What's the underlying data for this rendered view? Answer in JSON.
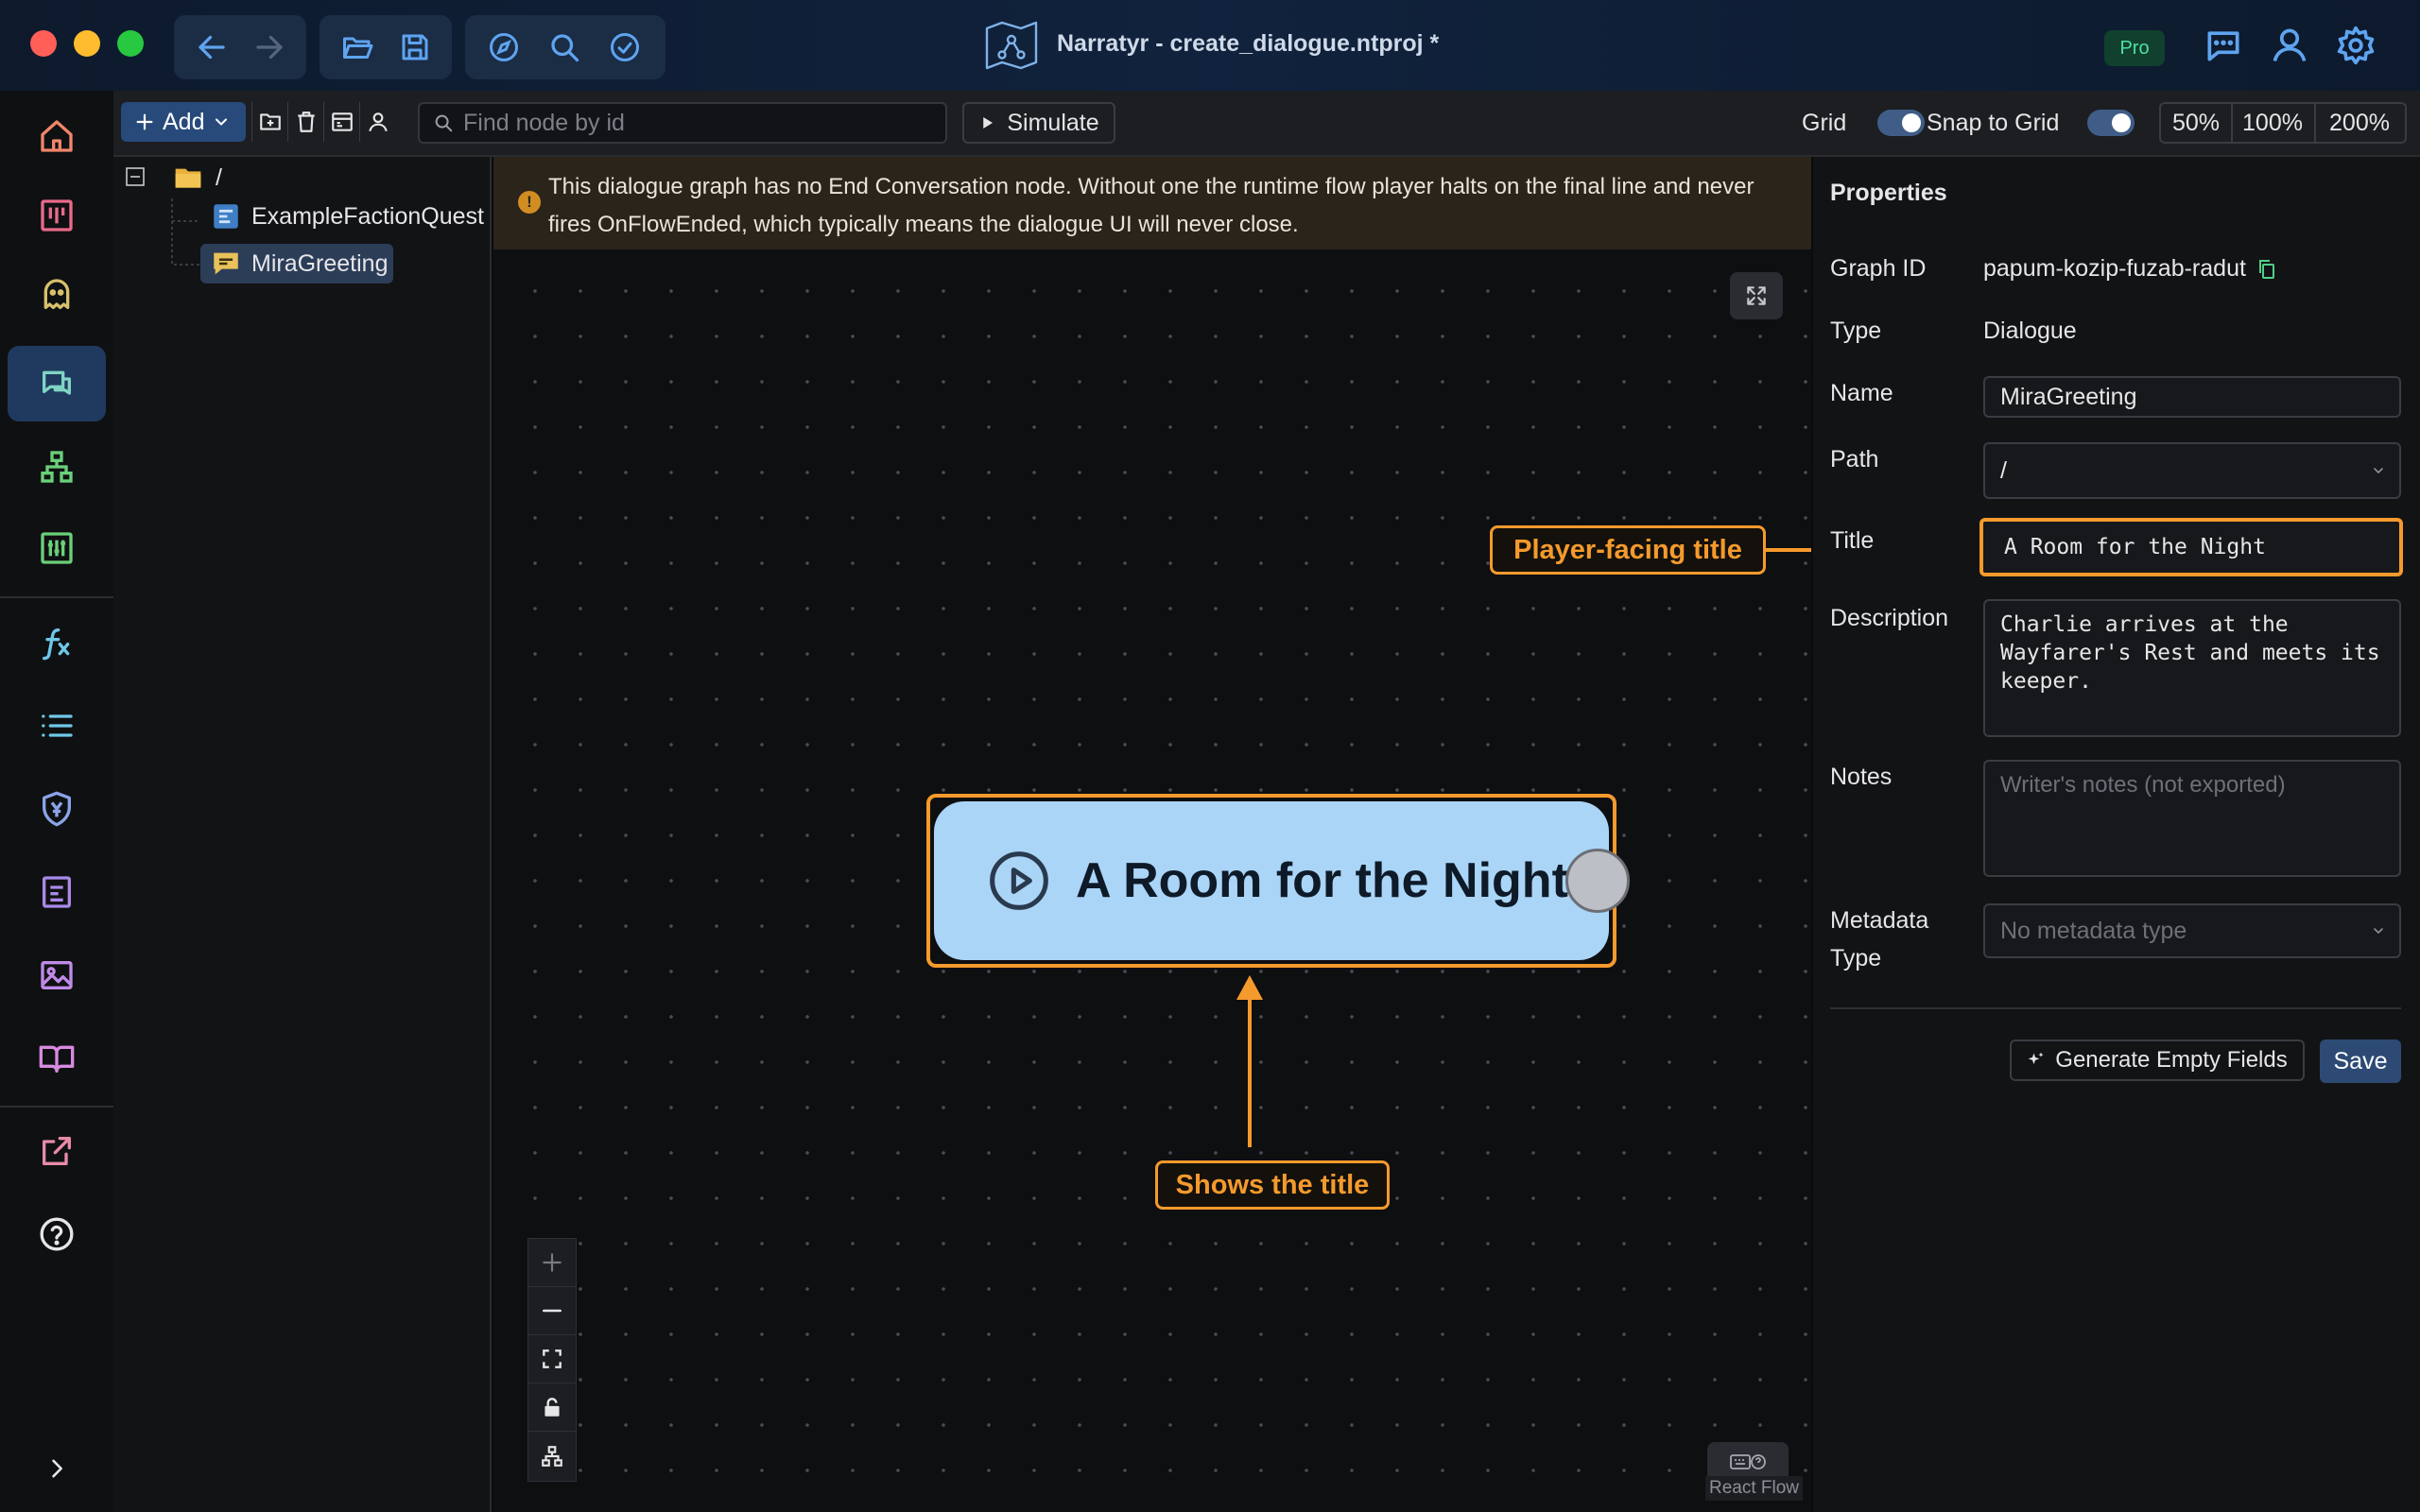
{
  "window": {
    "title": "Narratyr - create_dialogue.ntproj *",
    "badge": "Pro",
    "colors": {
      "accent": "#f59a2c",
      "node": "#aad5f7",
      "titlebar": "#10223d",
      "close": "#ff5f57",
      "minimize": "#febc2e",
      "zoom": "#28c840"
    }
  },
  "toolbar": {
    "add_label": "Add",
    "search_placeholder": "Find node by id",
    "simulate_label": "Simulate",
    "grid_label": "Grid",
    "snap_label": "Snap to Grid",
    "grid_on": true,
    "snap_on": true,
    "zoom_options": [
      "50%",
      "100%",
      "200%"
    ]
  },
  "tree": {
    "root": "/",
    "items": [
      {
        "label": "ExampleFactionQuest",
        "icon": "quest-icon"
      },
      {
        "label": "MiraGreeting",
        "icon": "dialogue-icon",
        "selected": true
      }
    ]
  },
  "canvas": {
    "warning": "This dialogue graph has no End Conversation node. Without one the runtime flow player halts on the final line and never fires OnFlowEnded, which typically means the dialogue UI will never close.",
    "node_title": "A Room for the Night",
    "callouts": {
      "title_field": "Player-facing title",
      "node": "Shows the title"
    },
    "attribution": "React Flow"
  },
  "properties": {
    "heading": "Properties",
    "graph_id_label": "Graph ID",
    "graph_id": "papum-kozip-fuzab-radut",
    "type_label": "Type",
    "type": "Dialogue",
    "name_label": "Name",
    "name": "MiraGreeting",
    "path_label": "Path",
    "path": "/",
    "title_label": "Title",
    "title": "A Room for the Night",
    "description_label": "Description",
    "description": "Charlie arrives at the\nWayfarer's Rest and meets its\nkeeper.",
    "notes_label": "Notes",
    "notes_placeholder": "Writer's notes (not exported)",
    "metadata_label_1": "Metadata",
    "metadata_label_2": "Type",
    "metadata_placeholder": "No metadata type",
    "generate_label": "Generate Empty Fields",
    "save_label": "Save"
  }
}
